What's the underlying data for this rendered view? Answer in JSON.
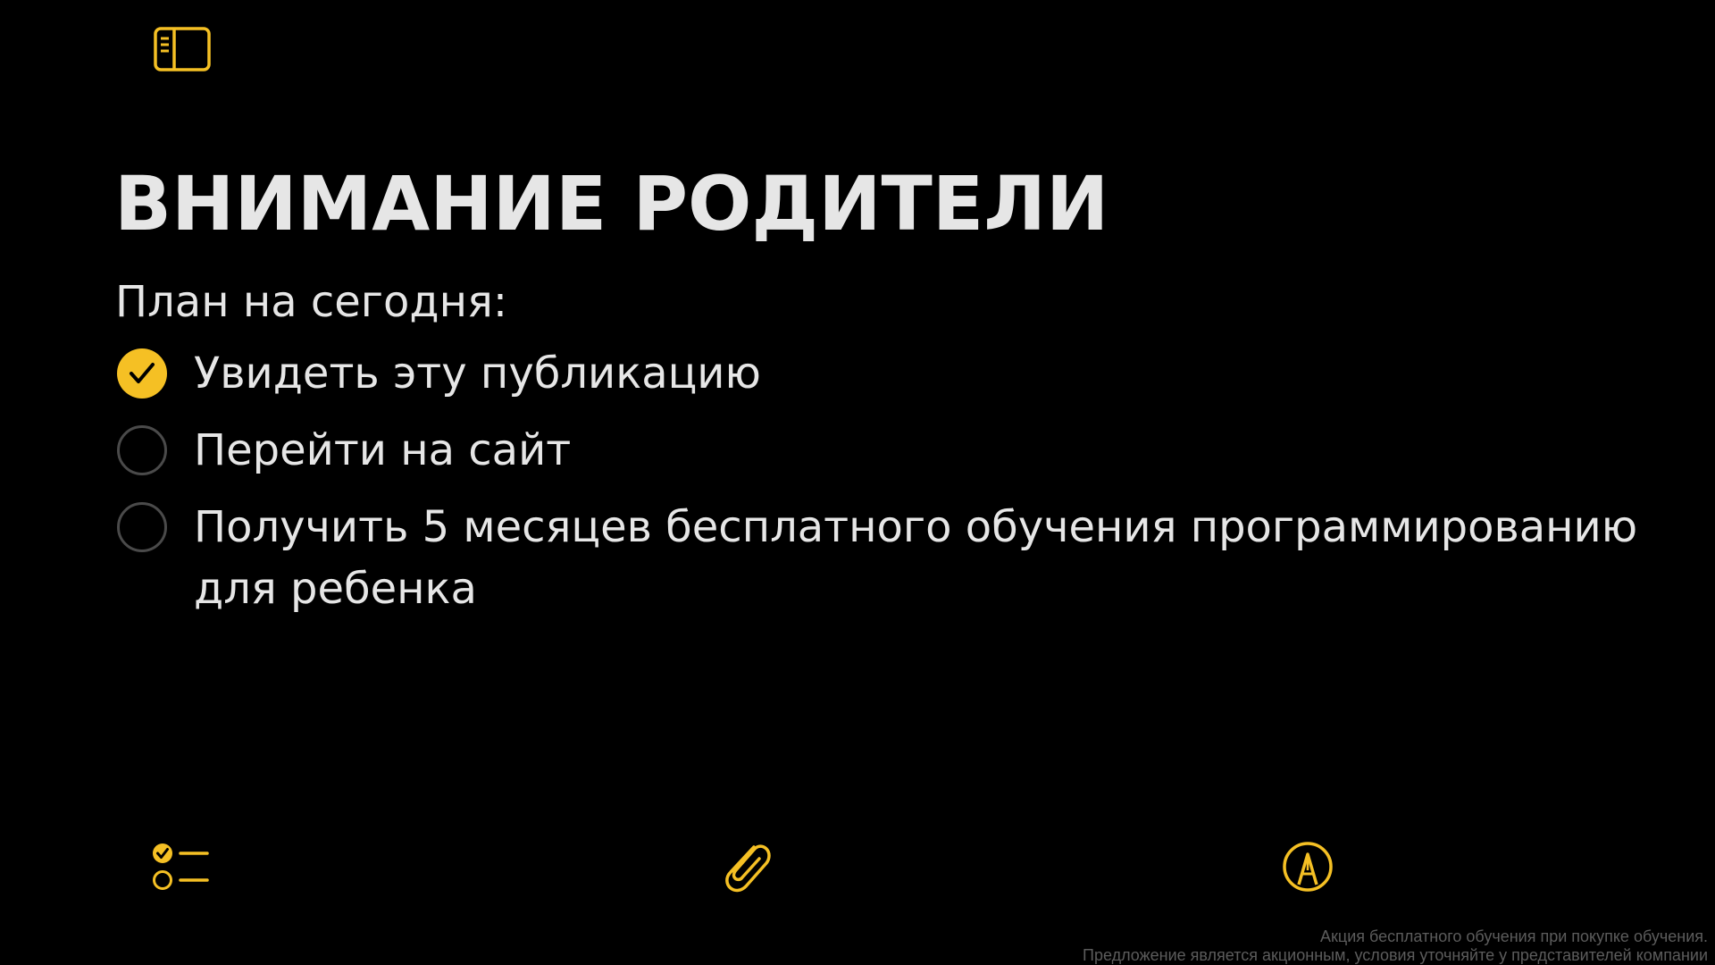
{
  "note": {
    "title": "ВНИМАНИЕ РОДИТЕЛИ",
    "subtitle": "План на сегодня:",
    "checklist": [
      {
        "label": "Увидеть эту публикацию",
        "checked": true
      },
      {
        "label": "Перейти на сайт",
        "checked": false
      },
      {
        "label": "Получить 5 месяцев бесплатного обучения программированию для ребенка",
        "checked": false
      }
    ]
  },
  "toolbar": {
    "top_icon": "sidebar-toggle-icon",
    "bottom_icons": [
      "checklist-icon",
      "paperclip-icon",
      "markup-pen-icon"
    ]
  },
  "disclaimer": {
    "line1": "Акция бесплатного обучения при покупке обучения.",
    "line2": "Предложение является акционным, условия уточняйте у представителей компании"
  },
  "colors": {
    "accent": "#f5c024",
    "background": "#000000",
    "text": "#e6e6e6",
    "unchecked_circle": "#4a4a4a",
    "disclaimer_text": "#5c5c5c"
  }
}
